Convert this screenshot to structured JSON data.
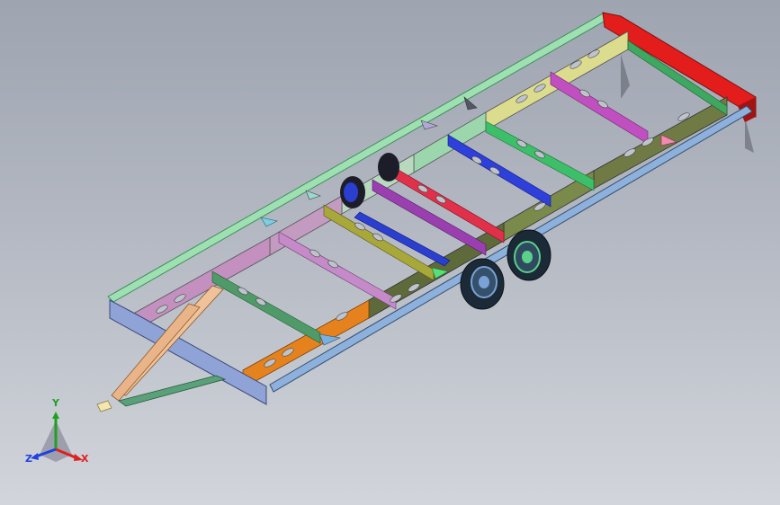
{
  "viewport": {
    "background_top": "#9ea4b0",
    "background_bottom": "#d2d5db"
  },
  "model": {
    "description_icon": "trailer-chassis-model",
    "colors": {
      "outline": "#3a3a3a",
      "rail_green": "#66d28c",
      "rail_blue": "#7aa2d6",
      "front_beam": "#e21f1f",
      "yellow": "#d9d98a",
      "magenta": "#c060c8",
      "green_cross": "#3fbf6a",
      "blue_cross": "#2f3fd9",
      "red_cross": "#e0304a",
      "purple_cross": "#9a3fb0",
      "olive_cross": "#a8a83a",
      "olive_dark": "#66703a",
      "pink": "#c08ab8",
      "orange": "#e5821e",
      "slate": "#6b7fb0",
      "peach": "#f0c29a",
      "teal": "#5aa07a",
      "wheel_dark": "#1d2a3a",
      "wheel_rim": "#5ad08a",
      "wheel_blue": "#2a3fd0"
    }
  },
  "triad": {
    "x_label": "X",
    "y_label": "Y",
    "z_label": "Z",
    "x_color": "#e02020",
    "y_color": "#20a020",
    "z_color": "#2040e0"
  }
}
